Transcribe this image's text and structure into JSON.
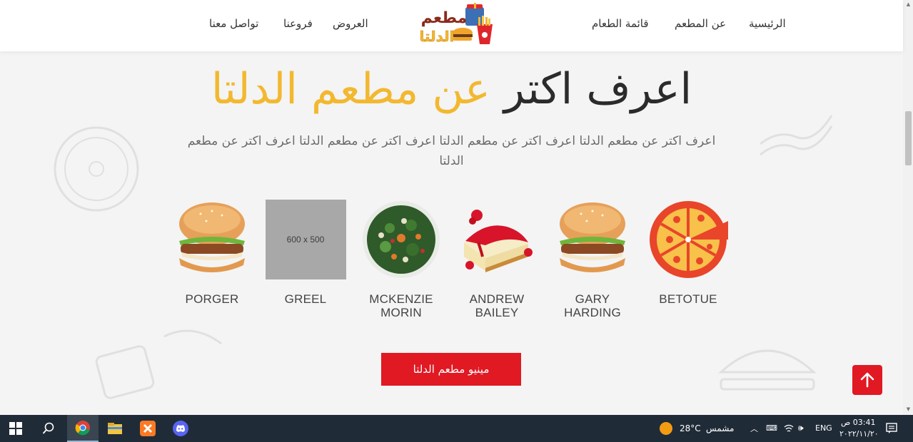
{
  "nav": {
    "home": "الرئيسية",
    "about": "عن المطعم",
    "menu": "قائمة الطعام",
    "offers": "العروض",
    "branches": "فروعنا",
    "contact": "تواصل معنا"
  },
  "logo": {
    "line1": "مطعم",
    "line2": "الدلتا"
  },
  "hero": {
    "title_dark": "اعرف اكتر",
    "title_gold": "عن مطعم الدلتا",
    "description": "اعرف اكتر عن مطعم الدلتا اعرف اكتر عن مطعم الدلتا اعرف اكتر عن مطعم الدلتا اعرف اكتر عن مطعم الدلتا"
  },
  "items": [
    {
      "label": "PORGER",
      "image": "burger"
    },
    {
      "label": "GREEL",
      "image": "placeholder",
      "placeholder_text": "600 x 500"
    },
    {
      "label": "MCKENZIE MORIN",
      "image": "salad"
    },
    {
      "label": "ANDREW BAILEY",
      "image": "cheesecake"
    },
    {
      "label": "GARY HARDING",
      "image": "burger"
    },
    {
      "label": "BETOTUE",
      "image": "pizza"
    }
  ],
  "menu_button": "مينيو مطعم الدلتا",
  "scroll_top_icon": "arrow-up-icon",
  "taskbar": {
    "weather_temp": "28°C",
    "weather_text": "مشمس",
    "language": "ENG",
    "time": "03:41 ص",
    "date": "٢٠٢٢/١١/٢٠",
    "apps": [
      "windows-start-icon",
      "search-icon",
      "chrome-icon",
      "file-explorer-icon",
      "xampp-icon",
      "discord-icon"
    ]
  },
  "colors": {
    "accent": "#e01923",
    "gold": "#f2b830",
    "taskbar": "#202b38"
  }
}
